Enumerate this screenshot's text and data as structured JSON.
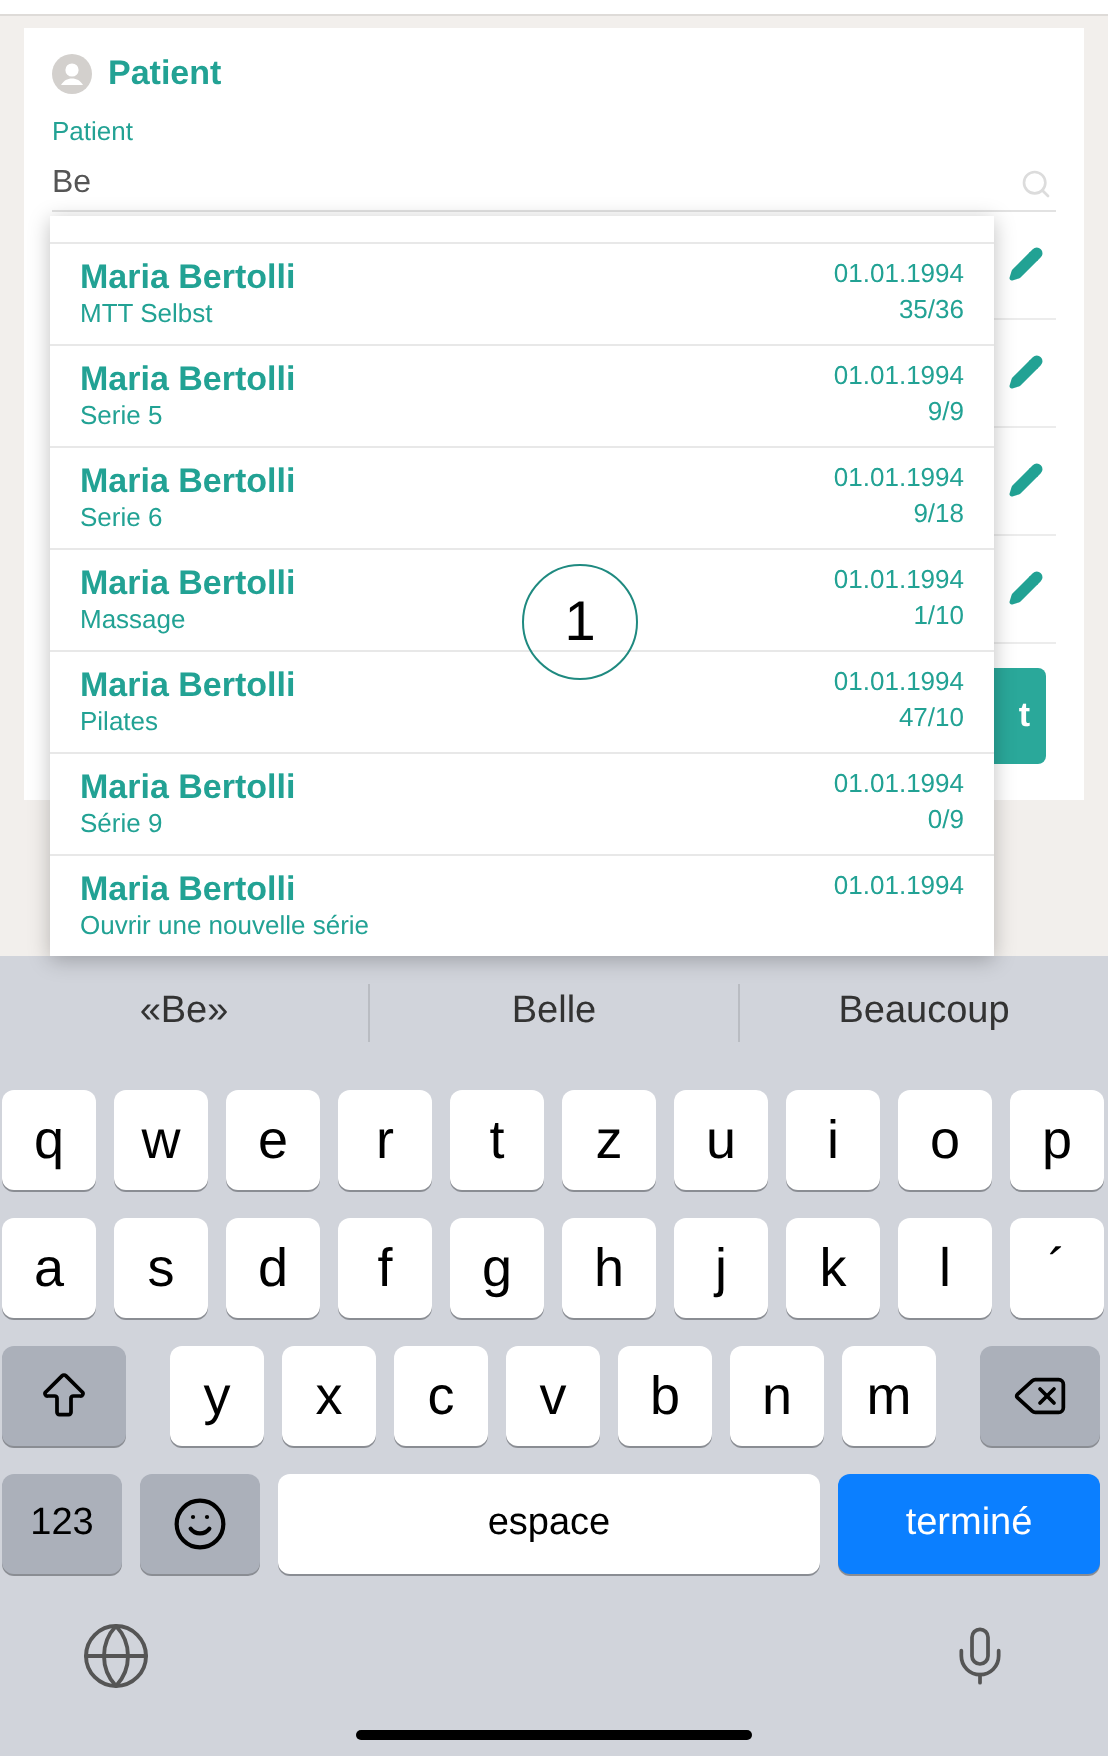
{
  "form": {
    "title": "Patient",
    "field": {
      "label": "Patient",
      "value": "Be"
    },
    "button": {
      "label": "t"
    },
    "rows": [
      {
        "kind": "edit"
      },
      {
        "kind": "edit"
      },
      {
        "kind": "edit"
      },
      {
        "kind": "edit"
      }
    ]
  },
  "dropdown": {
    "items": [
      {
        "name": "Maria Bertolli",
        "series": "MTT Selbst",
        "date": "01.01.1994",
        "count": "35/36"
      },
      {
        "name": "Maria Bertolli",
        "series": "Serie 5",
        "date": "01.01.1994",
        "count": "9/9"
      },
      {
        "name": "Maria Bertolli",
        "series": "Serie 6",
        "date": "01.01.1994",
        "count": "9/18"
      },
      {
        "name": "Maria Bertolli",
        "series": "Massage",
        "date": "01.01.1994",
        "count": "1/10"
      },
      {
        "name": "Maria Bertolli",
        "series": "Pilates",
        "date": "01.01.1994",
        "count": "47/10"
      },
      {
        "name": "Maria Bertolli",
        "series": "Série 9",
        "date": "01.01.1994",
        "count": "0/9"
      },
      {
        "name": "Maria Bertolli",
        "series": "Ouvrir une nouvelle série",
        "date": "01.01.1994"
      }
    ]
  },
  "callout": "1",
  "keyboard": {
    "suggestions": [
      "«Be»",
      "Belle",
      "Beaucoup"
    ],
    "key_rows": [
      {
        "keys": [
          {
            "kind": "letter",
            "label": "q"
          },
          {
            "kind": "letter",
            "label": "w"
          },
          {
            "kind": "letter",
            "label": "e"
          },
          {
            "kind": "letter",
            "label": "r"
          },
          {
            "kind": "letter",
            "label": "t"
          },
          {
            "kind": "letter",
            "label": "z"
          },
          {
            "kind": "letter",
            "label": "u"
          },
          {
            "kind": "letter",
            "label": "i"
          },
          {
            "kind": "letter",
            "label": "o"
          },
          {
            "kind": "letter",
            "label": "p"
          }
        ]
      },
      {
        "keys": [
          {
            "kind": "letter",
            "label": "a"
          },
          {
            "kind": "letter",
            "label": "s"
          },
          {
            "kind": "letter",
            "label": "d"
          },
          {
            "kind": "letter",
            "label": "f"
          },
          {
            "kind": "letter",
            "label": "g"
          },
          {
            "kind": "letter",
            "label": "h"
          },
          {
            "kind": "letter",
            "label": "j"
          },
          {
            "kind": "letter",
            "label": "k"
          },
          {
            "kind": "letter",
            "label": "l"
          },
          {
            "kind": "letter",
            "label": "´"
          }
        ]
      },
      {
        "keys": [
          {
            "kind": "shift"
          },
          {
            "kind": "letter",
            "label": "y"
          },
          {
            "kind": "letter",
            "label": "x"
          },
          {
            "kind": "letter",
            "label": "c"
          },
          {
            "kind": "letter",
            "label": "v"
          },
          {
            "kind": "letter",
            "label": "b"
          },
          {
            "kind": "letter",
            "label": "n"
          },
          {
            "kind": "letter",
            "label": "m"
          },
          {
            "kind": "delete"
          }
        ]
      },
      {
        "keys": [
          {
            "kind": "numbers",
            "label": "123"
          },
          {
            "kind": "emoji"
          },
          {
            "kind": "space",
            "label": "espace"
          },
          {
            "kind": "done",
            "label": "terminé"
          }
        ]
      }
    ]
  }
}
